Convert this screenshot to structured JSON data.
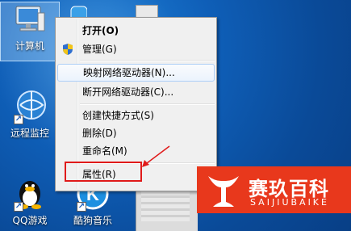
{
  "desktop": {
    "icons": [
      {
        "label": "计算机",
        "name": "computer"
      },
      {
        "label": "远程监控",
        "name": "remote-monitor"
      },
      {
        "label": "QQ游戏",
        "name": "qq-game"
      },
      {
        "label": "酷狗音乐",
        "name": "kugou-music"
      }
    ]
  },
  "context_menu": {
    "items": [
      {
        "label": "打开(O)",
        "bold": true
      },
      {
        "label": "管理(G)",
        "icon": "shield-icon"
      },
      {
        "label": "映射网络驱动器(N)..."
      },
      {
        "label": "断开网络驱动器(C)..."
      },
      {
        "label": "创建快捷方式(S)"
      },
      {
        "label": "删除(D)"
      },
      {
        "label": "重命名(M)"
      },
      {
        "label": "属性(R)"
      }
    ]
  },
  "annotation": {
    "highlight_color": "#e01a1a"
  },
  "watermark": {
    "title": "赛玖百科",
    "subtitle": "SAIJIUBAIKE",
    "color": "#e8381c"
  }
}
